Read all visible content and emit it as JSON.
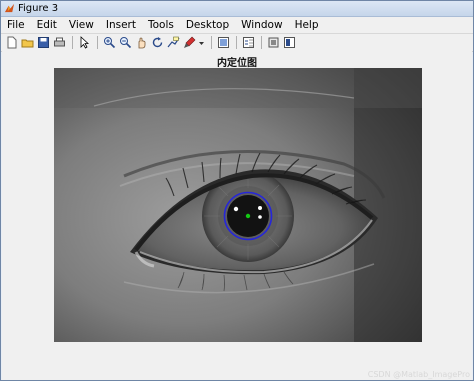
{
  "window": {
    "title": "Figure 3"
  },
  "menu": [
    "File",
    "Edit",
    "View",
    "Insert",
    "Tools",
    "Desktop",
    "Window",
    "Help"
  ],
  "toolbar_icons": [
    "new-figure-icon",
    "open-file-icon",
    "save-icon",
    "print-icon",
    "pointer-icon",
    "zoom-in-icon",
    "zoom-out-icon",
    "pan-icon",
    "rotate-icon",
    "data-cursor-icon",
    "brush-icon",
    "link-icon",
    "colorbar-icon",
    "legend-icon",
    "hide-plot-tools-icon",
    "show-plot-tools-icon"
  ],
  "figure": {
    "title": "内定位图",
    "watermark": "CSDN @Matlab_ImagePro"
  },
  "overlay": {
    "circle_color": "#2626d9",
    "center_color": "#13c913"
  }
}
